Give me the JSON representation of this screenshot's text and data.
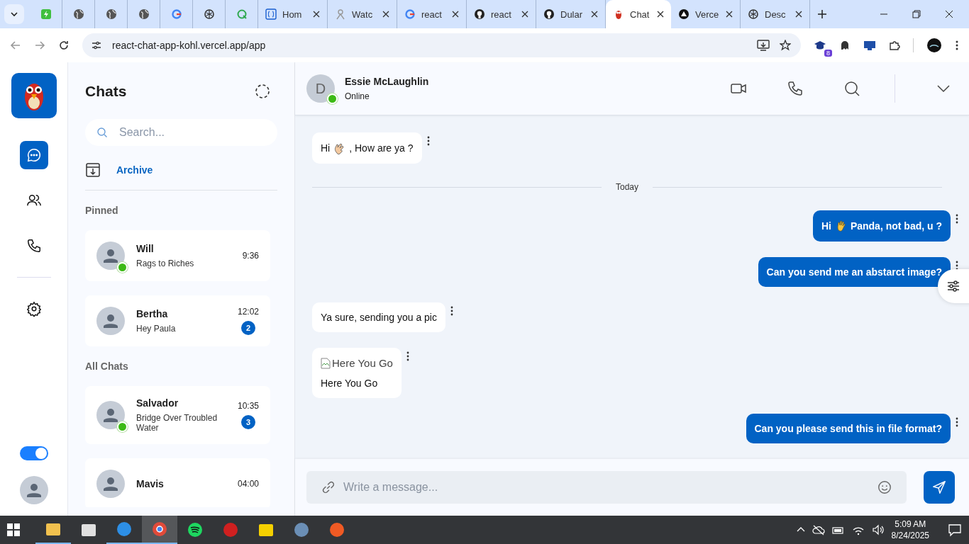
{
  "browser": {
    "tabs": [
      {
        "kind": "app",
        "selected": false
      },
      {
        "kind": "globe",
        "selected": false
      },
      {
        "kind": "globe",
        "selected": false
      },
      {
        "kind": "globe",
        "selected": false
      },
      {
        "kind": "google",
        "selected": false
      },
      {
        "kind": "knot",
        "selected": false
      },
      {
        "kind": "q",
        "selected": false
      },
      {
        "kind": "brace",
        "title": "Hom",
        "selected": false
      },
      {
        "kind": "figure",
        "title": "Watc",
        "selected": false
      },
      {
        "kind": "google",
        "title": "react",
        "selected": false
      },
      {
        "kind": "github",
        "title": "react",
        "selected": false
      },
      {
        "kind": "github",
        "title": "Dular",
        "selected": false
      },
      {
        "kind": "bird",
        "title": "Chat",
        "selected": true
      },
      {
        "kind": "triangle",
        "title": "Verce",
        "selected": false
      },
      {
        "kind": "knot",
        "title": "Desc",
        "selected": false
      }
    ],
    "address": "react-chat-app-kohl.vercel.app/app",
    "extension_badge": "8"
  },
  "rail": {
    "items": [
      {
        "kind": "chat",
        "selected": true
      },
      {
        "kind": "group",
        "selected": false
      },
      {
        "kind": "phone",
        "selected": false
      },
      {
        "kind": "settings",
        "selected": false
      }
    ],
    "theme_toggle": {
      "on": true
    }
  },
  "chats": {
    "title": "Chats",
    "search": {
      "placeholder": "Search..."
    },
    "archive": "Archive",
    "sections": [
      {
        "title": "Pinned",
        "items": [
          {
            "name": "Will",
            "message": "Rags to Riches",
            "time": "9:36",
            "online": true
          },
          {
            "name": "Bertha",
            "message": "Hey Paula",
            "time": "12:02",
            "online": false,
            "unread": "2"
          }
        ]
      },
      {
        "title": "All Chats",
        "items": [
          {
            "name": "Salvador",
            "message": "Bridge Over Troubled Water",
            "time": "10:35",
            "online": true,
            "unread": "3"
          },
          {
            "name": "Mavis",
            "time": "04:00",
            "online": false
          }
        ]
      }
    ]
  },
  "conversation": {
    "contact": {
      "initial": "D",
      "name": "Essie McLaughlin",
      "status": "Online",
      "online": true
    },
    "messages": [
      {
        "kind": "text",
        "incoming": true,
        "segments": [
          {
            "kind": "text",
            "text": "Hi"
          },
          {
            "kind": "clap"
          },
          {
            "kind": "text",
            "text": ", How are ya ?"
          }
        ]
      },
      {
        "kind": "divider",
        "text": "Today"
      },
      {
        "kind": "text",
        "incoming": false,
        "segments": [
          {
            "kind": "text",
            "text": "Hi"
          },
          {
            "kind": "wave"
          },
          {
            "kind": "text",
            "text": "Panda, not bad, u ?"
          }
        ]
      },
      {
        "kind": "text",
        "incoming": false,
        "segments": [
          {
            "kind": "text",
            "text": "Can you send me an abstarct image?"
          }
        ]
      },
      {
        "kind": "text",
        "incoming": true,
        "segments": [
          {
            "kind": "text",
            "text": "Ya sure, sending you a pic"
          }
        ]
      },
      {
        "kind": "image",
        "incoming": true,
        "alt": "Here You Go",
        "caption": "Here You Go"
      },
      {
        "kind": "text",
        "incoming": false,
        "segments": [
          {
            "kind": "text",
            "text": "Can you please send this in file format?"
          }
        ]
      }
    ],
    "composer": {
      "placeholder": "Write a message..."
    }
  },
  "taskbar": {
    "apps": [
      {
        "kind": "folder",
        "active": true
      },
      {
        "kind": "store",
        "active": false
      },
      {
        "kind": "code",
        "active": true
      },
      {
        "kind": "chrome",
        "active": true
      },
      {
        "kind": "spotify",
        "active": false
      },
      {
        "kind": "shield",
        "active": false
      },
      {
        "kind": "note",
        "active": false
      },
      {
        "kind": "elephant",
        "active": false
      },
      {
        "kind": "lion",
        "active": false
      }
    ],
    "time": "5:09 AM",
    "date": "8/24/2025"
  }
}
